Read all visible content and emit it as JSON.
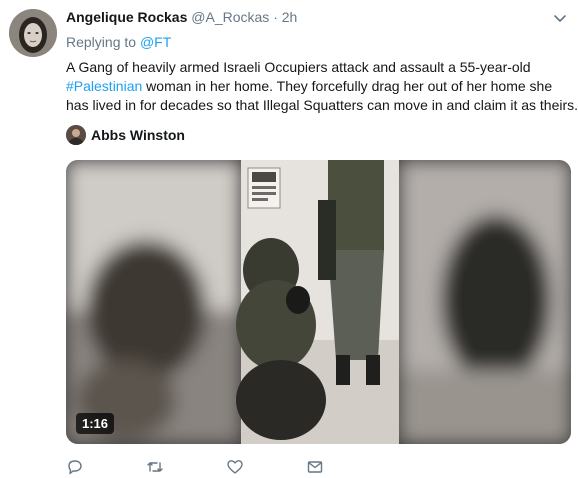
{
  "tweet": {
    "author_name": "Angelique Rockas",
    "author_handle": "@A_Rockas",
    "separator": "·",
    "time": "2h",
    "replying_prefix": "Replying to",
    "replying_to": "@FT",
    "text_line1": "A Gang of heavily armed Israeli Occupiers attack and assault a 55-year-old",
    "hashtag": "#Palestinian",
    "text_line2_rest": " woman in her home. They forcefully drag her out of her home she",
    "text_line3": "has lived in for decades so that Illegal Squatters can move in and claim it as theirs."
  },
  "attribution": {
    "name": "Abbs Winston"
  },
  "media": {
    "duration": "1:16",
    "watermark_icon": "btselem-logo-icon"
  },
  "actions": [
    {
      "name": "reply-button",
      "icon": "reply-icon"
    },
    {
      "name": "retweet-button",
      "icon": "retweet-icon"
    },
    {
      "name": "like-button",
      "icon": "heart-icon"
    },
    {
      "name": "direct-message-button",
      "icon": "envelope-icon"
    }
  ],
  "colors": {
    "link": "#1da1f2",
    "secondary_text": "#657786",
    "text": "#14171a"
  }
}
